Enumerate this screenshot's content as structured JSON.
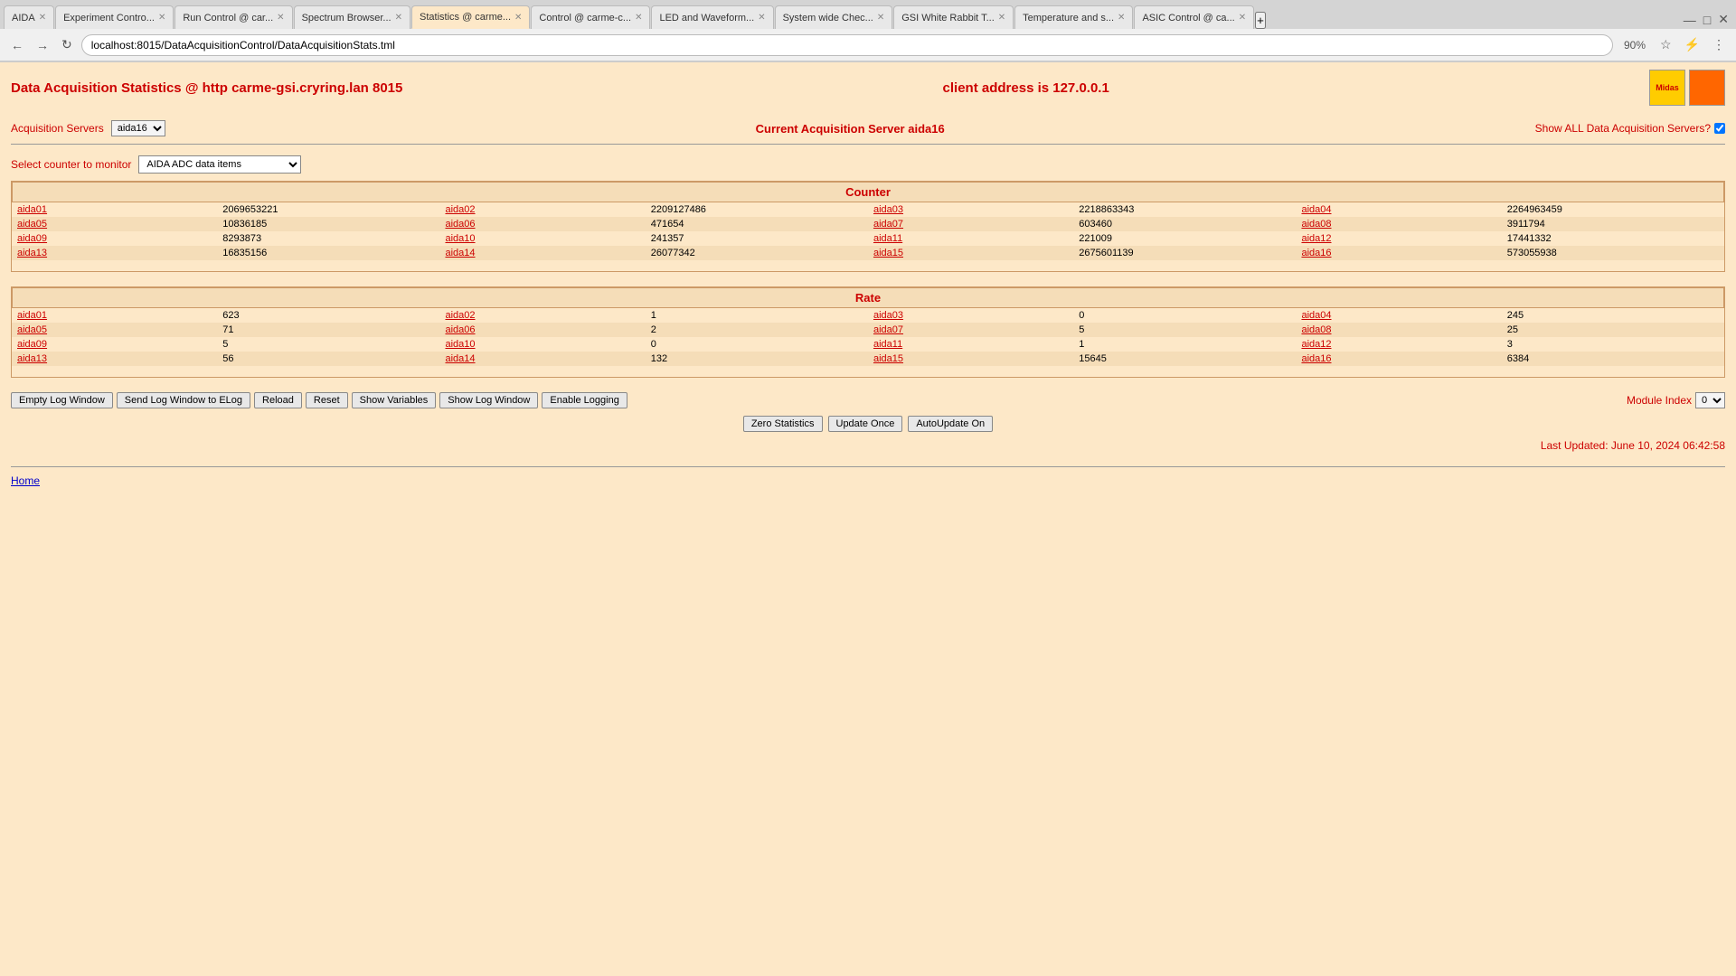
{
  "browser": {
    "address": "localhost:8015/DataAcquisitionControl/DataAcquisitionStats.tml",
    "zoom": "90%",
    "tabs": [
      {
        "label": "AIDA",
        "active": false
      },
      {
        "label": "Experiment Contro...",
        "active": false
      },
      {
        "label": "Run Control @ car...",
        "active": false
      },
      {
        "label": "Spectrum Browser...",
        "active": false
      },
      {
        "label": "Statistics @ carme...",
        "active": true
      },
      {
        "label": "Control @ carme-c...",
        "active": false
      },
      {
        "label": "LED and Waveform...",
        "active": false
      },
      {
        "label": "System wide Chec...",
        "active": false
      },
      {
        "label": "GSI White Rabbit T...",
        "active": false
      },
      {
        "label": "Temperature and s...",
        "active": false
      },
      {
        "label": "ASIC Control @ ca...",
        "active": false
      }
    ]
  },
  "page": {
    "title": "Data Acquisition Statistics @ http carme-gsi.cryring.lan 8015",
    "client_address_label": "client address is 127.0.0.1"
  },
  "acquisition": {
    "servers_label": "Acquisition Servers",
    "server_value": "aida16",
    "current_label": "Current Acquisition Server aida16",
    "show_all_label": "Show ALL Data Acquisition Servers?"
  },
  "counter_select": {
    "label": "Select counter to monitor",
    "value": "AIDA ADC data items"
  },
  "counter_table": {
    "header": "Counter",
    "rows": [
      {
        "c1": "aida01",
        "v1": "2069653221",
        "c2": "aida02",
        "v2": "2209127486",
        "c3": "aida03",
        "v3": "2218863343",
        "c4": "aida04",
        "v4": "2264963459"
      },
      {
        "c1": "aida05",
        "v1": "10836185",
        "c2": "aida06",
        "v2": "471654",
        "c3": "aida07",
        "v3": "603460",
        "c4": "aida08",
        "v4": "3911794"
      },
      {
        "c1": "aida09",
        "v1": "8293873",
        "c2": "aida10",
        "v2": "241357",
        "c3": "aida11",
        "v3": "221009",
        "c4": "aida12",
        "v4": "17441332"
      },
      {
        "c1": "aida13",
        "v1": "16835156",
        "c2": "aida14",
        "v2": "26077342",
        "c3": "aida15",
        "v3": "2675601139",
        "c4": "aida16",
        "v4": "573055938"
      }
    ]
  },
  "rate_table": {
    "header": "Rate",
    "rows": [
      {
        "c1": "aida01",
        "v1": "623",
        "c2": "aida02",
        "v2": "1",
        "c3": "aida03",
        "v3": "0",
        "c4": "aida04",
        "v4": "245"
      },
      {
        "c1": "aida05",
        "v1": "71",
        "c2": "aida06",
        "v2": "2",
        "c3": "aida07",
        "v3": "5",
        "c4": "aida08",
        "v4": "25"
      },
      {
        "c1": "aida09",
        "v1": "5",
        "c2": "aida10",
        "v2": "0",
        "c3": "aida11",
        "v3": "1",
        "c4": "aida12",
        "v4": "3"
      },
      {
        "c1": "aida13",
        "v1": "56",
        "c2": "aida14",
        "v2": "132",
        "c3": "aida15",
        "v3": "15645",
        "c4": "aida16",
        "v4": "6384"
      }
    ]
  },
  "buttons": {
    "empty_log_window": "Empty Log Window",
    "send_log": "Send Log Window to ELog",
    "reload": "Reload",
    "reset": "Reset",
    "show_variables": "Show Variables",
    "show_log_window": "Show Log Window",
    "enable_logging": "Enable Logging",
    "zero_statistics": "Zero Statistics",
    "update_once": "Update Once",
    "autoupdate_on": "AutoUpdate On",
    "module_index_label": "Module Index",
    "module_index_value": "0"
  },
  "footer": {
    "last_updated": "Last Updated: June 10, 2024 06:42:58",
    "home_link": "Home"
  }
}
